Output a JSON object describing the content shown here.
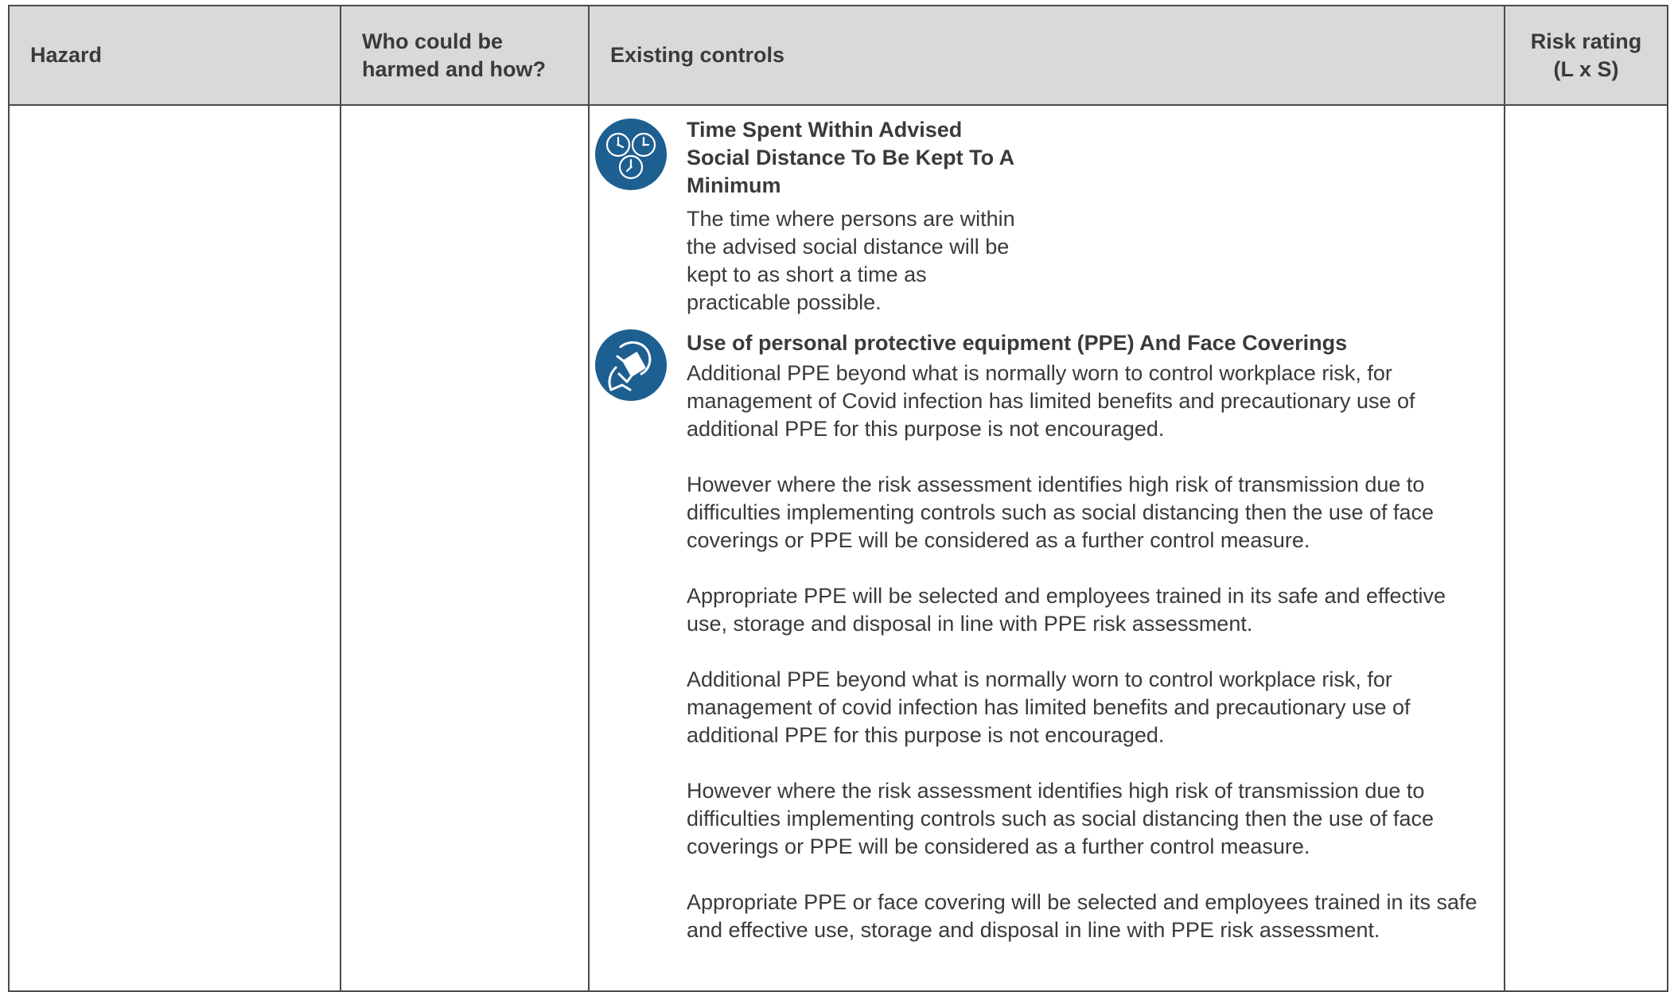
{
  "table": {
    "headers": {
      "hazard": "Hazard",
      "who": "Who could be harmed and how?",
      "controls": "Existing controls",
      "rating": "Risk rating (L x S)"
    }
  },
  "controls": [
    {
      "icon": "clocks-icon",
      "title": "Time Spent Within Advised Social Distance To Be Kept To A Minimum",
      "paragraphs": [
        "The time where persons are within the advised social distance will be kept to as short a time as practicable possible."
      ]
    },
    {
      "icon": "face-mask-icon",
      "title": "Use of personal protective equipment (PPE) And Face Coverings",
      "paragraphs": [
        "Additional PPE beyond what is normally worn to control workplace risk, for management of Covid infection has limited benefits and precautionary use of additional PPE for this purpose is not encouraged.",
        "However where the risk assessment identifies high risk of transmission due to difficulties implementing controls such as social distancing then the use of face coverings or PPE will be considered as a further control measure.",
        "Appropriate PPE will be selected and employees trained in its safe and effective use, storage and disposal in line with PPE risk assessment.",
        "Additional PPE beyond what is normally worn to control workplace risk, for management of covid infection has limited benefits and precautionary use of additional PPE for this purpose is not encouraged.",
        "However where the risk assessment identifies high risk of transmission due to difficulties implementing controls such as social distancing then the use of face coverings or PPE will be considered as a further control measure.",
        "Appropriate PPE or face covering will be selected and employees trained in its safe and effective use, storage and disposal in line with PPE risk assessment."
      ]
    }
  ],
  "colors": {
    "header_bg": "#d9d9d9",
    "icon_blue": "#1e5f91",
    "text": "#3a3a3a",
    "border": "#4a4a4a"
  }
}
